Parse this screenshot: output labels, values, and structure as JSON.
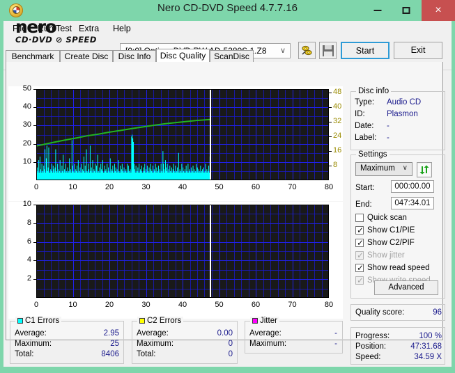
{
  "window": {
    "title": "Nero CD-DVD Speed 4.7.7.16",
    "app_icon": "nero-disc-icon",
    "minimize_label": "minimize-icon",
    "maximize_label": "maximize-icon",
    "close_label": "×",
    "close_color": "#c75050",
    "frame_color": "#7ed6ab"
  },
  "menu": [
    {
      "label": "File"
    },
    {
      "label": "Run Test"
    },
    {
      "label": "Extra"
    },
    {
      "label": "Help"
    }
  ],
  "toolbar": {
    "logo_line1": "nero",
    "logo_line2": "CD·DVD ⊘ SPEED",
    "drive_combo": {
      "value": "[0:0]   Optiarc DVD RW AD-5280S 1.Z8",
      "arrow": "∨"
    },
    "eject_icon": "eject-disc-icon",
    "save_icon": "save-floppy-icon",
    "start_label": "Start",
    "exit_label": "Exit",
    "start_focus_color": "#2e9bd6"
  },
  "tabs": [
    {
      "label": "Benchmark",
      "active": false
    },
    {
      "label": "Create Disc",
      "active": false
    },
    {
      "label": "Disc Info",
      "active": false
    },
    {
      "label": "Disc Quality",
      "active": true
    },
    {
      "label": "ScanDisc",
      "active": false
    }
  ],
  "chart_data": [
    {
      "type": "area",
      "name": "c1-errors-chart",
      "title": "",
      "xlabel": "",
      "ylabel": "",
      "xlim": [
        0,
        80
      ],
      "ylim": [
        0,
        50
      ],
      "y2lim": [
        0,
        50
      ],
      "grid": true,
      "xticks": [
        0,
        10,
        20,
        30,
        40,
        50,
        60,
        70,
        80
      ],
      "yticks": [
        10,
        20,
        30,
        40,
        50
      ],
      "y2ticks": [
        8,
        16,
        24,
        32,
        40,
        48
      ],
      "y2label_color": "#9a8b00",
      "cursor_x": 47.5,
      "series": [
        {
          "name": "C1 Errors",
          "color": "#00ffff",
          "kind": "area",
          "x_end": 47.5,
          "values": [
            18,
            5,
            7,
            3,
            11,
            4,
            13,
            6,
            4,
            9,
            5,
            3,
            8,
            6,
            17,
            4,
            12,
            19,
            5,
            7,
            18,
            4,
            3,
            6,
            5,
            9,
            4,
            8,
            6,
            3,
            7,
            17,
            5,
            4,
            9,
            3,
            6,
            5,
            11,
            4,
            3,
            8,
            5,
            14,
            4,
            6,
            3,
            9,
            5,
            4,
            7,
            3,
            5,
            12,
            4,
            6,
            3,
            22,
            8,
            5,
            4,
            9,
            3,
            6,
            5,
            8,
            4,
            11,
            3,
            5,
            7,
            4,
            9,
            3,
            6,
            5,
            13,
            4,
            8,
            3,
            17,
            5,
            4,
            9,
            6,
            3,
            19,
            5,
            7,
            4,
            11,
            3,
            6,
            5,
            9,
            4,
            8,
            3,
            14,
            5,
            4,
            7,
            3,
            9,
            6,
            5,
            11,
            4,
            3,
            8,
            5,
            6,
            4,
            9,
            3,
            7,
            5,
            4,
            12,
            3,
            6,
            5,
            8,
            4,
            3,
            9,
            5,
            7,
            4,
            6,
            3,
            11,
            5,
            4,
            8,
            3,
            6,
            9,
            5,
            4,
            7,
            3,
            5,
            6,
            4,
            9,
            3,
            8,
            5,
            4,
            6,
            3,
            24,
            25,
            23,
            21,
            9,
            6,
            4,
            8,
            3,
            5,
            7,
            4,
            9,
            3,
            6,
            5,
            8,
            4,
            3,
            7,
            5,
            9,
            4,
            6,
            3,
            8,
            5,
            4,
            7,
            3,
            9,
            6,
            5,
            4,
            8,
            3,
            6,
            5,
            9,
            4,
            7,
            3,
            5,
            8,
            4,
            6,
            3,
            9,
            5,
            4,
            16,
            9,
            6,
            4,
            11,
            7,
            5,
            9,
            4,
            6,
            3,
            8,
            5,
            4,
            7,
            3,
            6,
            9,
            5,
            4,
            8,
            3,
            5,
            7,
            4,
            15,
            3,
            6,
            5,
            4,
            9,
            3,
            7,
            5,
            4,
            6,
            3,
            8,
            5,
            4,
            9,
            3,
            6,
            5,
            4,
            7,
            3,
            5,
            8,
            4,
            6,
            3,
            5,
            9,
            4,
            7,
            3,
            6,
            5,
            4,
            8,
            3,
            5,
            6,
            4,
            7,
            3,
            5,
            9,
            4,
            6,
            3,
            5,
            8,
            4,
            13
          ]
        },
        {
          "name": "read speed",
          "color": "#22b422",
          "kind": "line",
          "x_end": 47.5,
          "points": [
            [
              0,
              18.8
            ],
            [
              2,
              19.6
            ],
            [
              5,
              20.9
            ],
            [
              8,
              22.1
            ],
            [
              11,
              23.2
            ],
            [
              14,
              24.4
            ],
            [
              17,
              25.3
            ],
            [
              20,
              26.4
            ],
            [
              23,
              27.3
            ],
            [
              26,
              28.3
            ],
            [
              29,
              29.2
            ],
            [
              32,
              30.1
            ],
            [
              35,
              30.9
            ],
            [
              38,
              31.6
            ],
            [
              41,
              32.2
            ],
            [
              44,
              32.8
            ],
            [
              47.5,
              33.3
            ]
          ]
        }
      ]
    },
    {
      "type": "area",
      "name": "c2-errors-chart",
      "title": "",
      "xlabel": "",
      "ylabel": "",
      "xlim": [
        0,
        80
      ],
      "ylim": [
        0,
        10
      ],
      "grid": true,
      "xticks": [
        0,
        10,
        20,
        30,
        40,
        50,
        60,
        70,
        80
      ],
      "yticks": [
        2,
        4,
        6,
        8,
        10
      ],
      "cursor_x": 47.5,
      "series": [
        {
          "name": "C2 Errors",
          "color": "#ffff00",
          "kind": "area",
          "x_end": 47.5,
          "values": []
        }
      ]
    }
  ],
  "stats": {
    "c1": {
      "title": "C1 Errors",
      "swatch": "#00ffff",
      "rows": [
        {
          "label": "Average:",
          "value": "2.95"
        },
        {
          "label": "Maximum:",
          "value": "25"
        },
        {
          "label": "Total:",
          "value": "8406"
        }
      ]
    },
    "c2": {
      "title": "C2 Errors",
      "swatch": "#ffff00",
      "rows": [
        {
          "label": "Average:",
          "value": "0.00"
        },
        {
          "label": "Maximum:",
          "value": "0"
        },
        {
          "label": "Total:",
          "value": "0"
        }
      ]
    },
    "jitter": {
      "title": "Jitter",
      "swatch": "#ff00ff",
      "rows": [
        {
          "label": "Average:",
          "value": "-"
        },
        {
          "label": "Maximum:",
          "value": "-"
        }
      ]
    }
  },
  "disc_info": {
    "title": "Disc info",
    "rows": [
      {
        "label": "Type:",
        "value": "Audio CD"
      },
      {
        "label": "ID:",
        "value": "Plasmon"
      },
      {
        "label": "Date:",
        "value": "-"
      },
      {
        "label": "Label:",
        "value": "-"
      }
    ]
  },
  "settings": {
    "title": "Settings",
    "speed_select": {
      "value": "Maximum",
      "arrow": "∨"
    },
    "refresh_icon": "refresh-recycle-icon",
    "start_label": "Start:",
    "start_value": "000:00.00",
    "end_label": "End:",
    "end_value": "047:34.01",
    "checkboxes": [
      {
        "label": "Quick scan",
        "checked": false,
        "enabled": true
      },
      {
        "label": "Show C1/PIE",
        "checked": true,
        "enabled": true
      },
      {
        "label": "Show C2/PIF",
        "checked": true,
        "enabled": true
      },
      {
        "label": "Show jitter",
        "checked": true,
        "enabled": false
      },
      {
        "label": "Show read speed",
        "checked": true,
        "enabled": true
      },
      {
        "label": "Show write speed",
        "checked": true,
        "enabled": false
      }
    ],
    "advanced_label": "Advanced"
  },
  "quality": {
    "label": "Quality score:",
    "value": "96"
  },
  "progress": {
    "rows": [
      {
        "label": "Progress:",
        "value": "100 %"
      },
      {
        "label": "Position:",
        "value": "47:31.68"
      },
      {
        "label": "Speed:",
        "value": "34.59 X"
      }
    ]
  }
}
